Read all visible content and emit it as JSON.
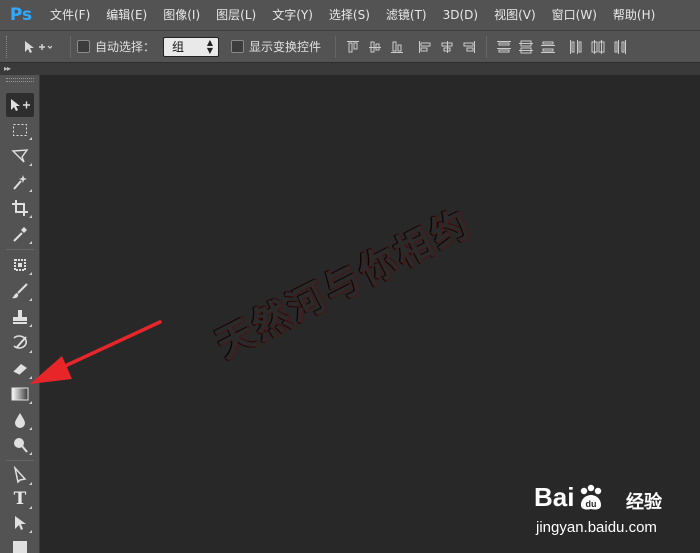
{
  "app": {
    "logo": "Ps",
    "menu": [
      "文件(F)",
      "编辑(E)",
      "图像(I)",
      "图层(L)",
      "文字(Y)",
      "选择(S)",
      "滤镜(T)",
      "3D(D)",
      "视图(V)",
      "窗口(W)",
      "帮助(H)"
    ]
  },
  "options": {
    "tool_icon": "move-tool-icon",
    "auto_select_label": "自动选择：",
    "auto_select_checked": false,
    "auto_select_value": "组",
    "show_transform_label": "显示变换控件",
    "show_transform_checked": false
  },
  "toolbar": {
    "tools": [
      {
        "name": "move-tool",
        "icon": "move-icon",
        "active": true
      },
      {
        "name": "marquee-tool",
        "icon": "rectangular-marquee-icon"
      },
      {
        "name": "lasso-tool",
        "icon": "polygonal-lasso-icon"
      },
      {
        "name": "magic-wand-tool",
        "icon": "magic-wand-icon"
      },
      {
        "name": "crop-tool",
        "icon": "crop-icon"
      },
      {
        "name": "eyedropper-tool",
        "icon": "eyedropper-icon"
      },
      {
        "name": "healing-brush-tool",
        "icon": "healing-brush-icon"
      },
      {
        "name": "brush-tool",
        "icon": "brush-icon"
      },
      {
        "name": "clone-stamp-tool",
        "icon": "clone-stamp-icon"
      },
      {
        "name": "history-brush-tool",
        "icon": "history-brush-icon"
      },
      {
        "name": "eraser-tool",
        "icon": "eraser-icon"
      },
      {
        "name": "gradient-tool",
        "icon": "gradient-icon"
      },
      {
        "name": "blur-tool",
        "icon": "blur-icon"
      },
      {
        "name": "dodge-tool",
        "icon": "dodge-icon"
      },
      {
        "name": "pen-tool",
        "icon": "pen-icon"
      },
      {
        "name": "type-tool",
        "icon": "type-icon",
        "label": "T"
      },
      {
        "name": "path-selection-tool",
        "icon": "path-selection-icon"
      },
      {
        "name": "shape-tool",
        "icon": "rectangle-shape-icon"
      }
    ]
  },
  "annotation": {
    "arrow_color": "#e8262a",
    "points_to": "gradient-tool"
  },
  "watermark": {
    "text": "天然河与你相约",
    "color": "#4a1818"
  },
  "baidu": {
    "logo_left": "Bai",
    "logo_right": "u",
    "product": "经验",
    "url": "jingyan.baidu.com"
  },
  "colors": {
    "menubar_bg": "#535353",
    "canvas_bg": "#282828",
    "ps_blue": "#31a8ff"
  }
}
